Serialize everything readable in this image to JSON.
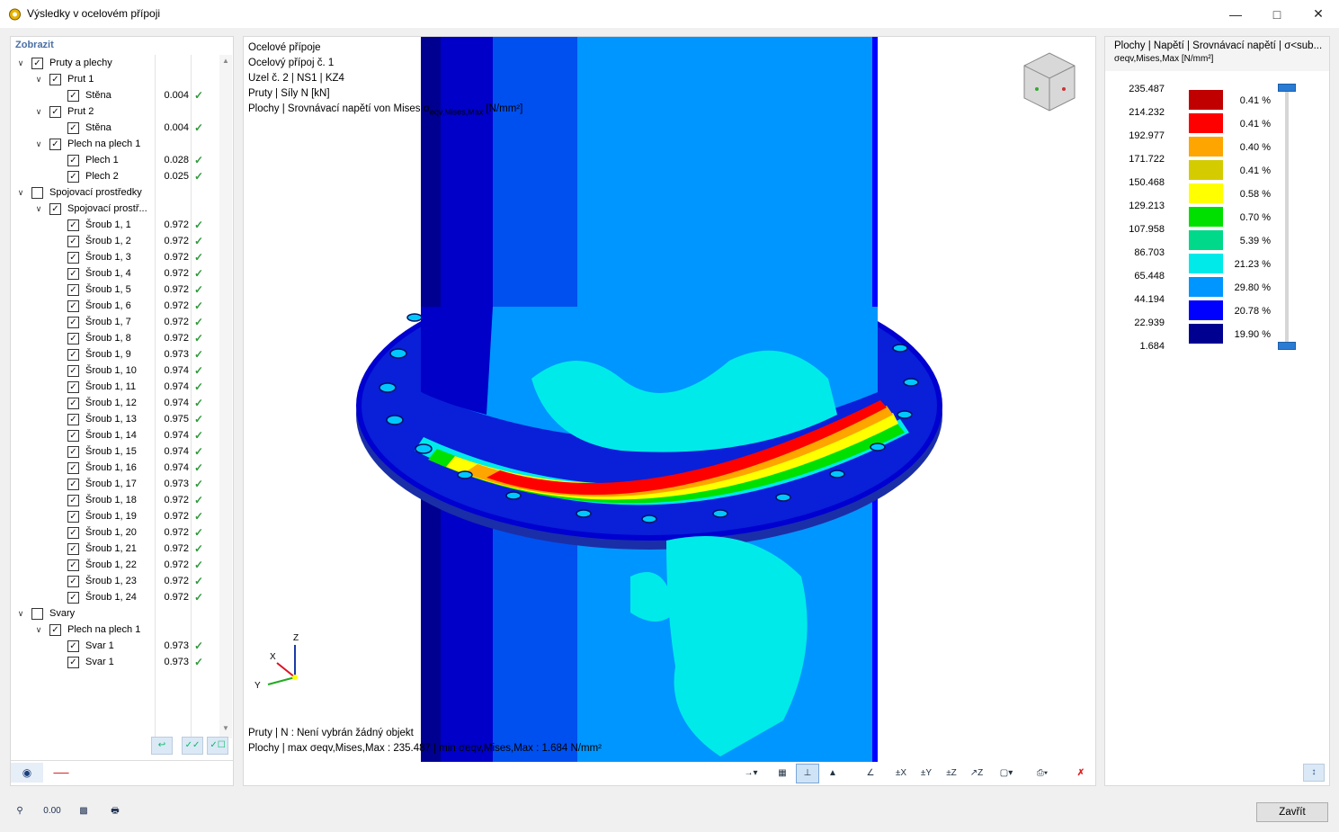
{
  "window": {
    "title": "Výsledky v ocelovém přípoji"
  },
  "left_panel": {
    "header": "Zobrazit",
    "tree": [
      {
        "level": 0,
        "expand": true,
        "checked": true,
        "label": "Pruty a plechy",
        "value": "",
        "ok": false
      },
      {
        "level": 1,
        "expand": true,
        "checked": true,
        "label": "Prut 1",
        "value": "",
        "ok": false
      },
      {
        "level": 2,
        "expand": false,
        "checked": true,
        "label": "Stěna",
        "value": "0.004",
        "ok": true
      },
      {
        "level": 1,
        "expand": true,
        "checked": true,
        "label": "Prut 2",
        "value": "",
        "ok": false
      },
      {
        "level": 2,
        "expand": false,
        "checked": true,
        "label": "Stěna",
        "value": "0.004",
        "ok": true
      },
      {
        "level": 1,
        "expand": true,
        "checked": true,
        "label": "Plech na plech 1",
        "value": "",
        "ok": false
      },
      {
        "level": 2,
        "expand": false,
        "checked": true,
        "label": "Plech 1",
        "value": "0.028",
        "ok": true
      },
      {
        "level": 2,
        "expand": false,
        "checked": true,
        "label": "Plech 2",
        "value": "0.025",
        "ok": true
      },
      {
        "level": 0,
        "expand": true,
        "checked": false,
        "label": "Spojovací prostředky",
        "value": "",
        "ok": false
      },
      {
        "level": 1,
        "expand": true,
        "checked": true,
        "label": "Spojovací prostř...",
        "value": "",
        "ok": false
      },
      {
        "level": 2,
        "expand": false,
        "checked": true,
        "label": "Šroub 1, 1",
        "value": "0.972",
        "ok": true
      },
      {
        "level": 2,
        "expand": false,
        "checked": true,
        "label": "Šroub 1, 2",
        "value": "0.972",
        "ok": true
      },
      {
        "level": 2,
        "expand": false,
        "checked": true,
        "label": "Šroub 1, 3",
        "value": "0.972",
        "ok": true
      },
      {
        "level": 2,
        "expand": false,
        "checked": true,
        "label": "Šroub 1, 4",
        "value": "0.972",
        "ok": true
      },
      {
        "level": 2,
        "expand": false,
        "checked": true,
        "label": "Šroub 1, 5",
        "value": "0.972",
        "ok": true
      },
      {
        "level": 2,
        "expand": false,
        "checked": true,
        "label": "Šroub 1, 6",
        "value": "0.972",
        "ok": true
      },
      {
        "level": 2,
        "expand": false,
        "checked": true,
        "label": "Šroub 1, 7",
        "value": "0.972",
        "ok": true
      },
      {
        "level": 2,
        "expand": false,
        "checked": true,
        "label": "Šroub 1, 8",
        "value": "0.972",
        "ok": true
      },
      {
        "level": 2,
        "expand": false,
        "checked": true,
        "label": "Šroub 1, 9",
        "value": "0.973",
        "ok": true
      },
      {
        "level": 2,
        "expand": false,
        "checked": true,
        "label": "Šroub 1, 10",
        "value": "0.974",
        "ok": true
      },
      {
        "level": 2,
        "expand": false,
        "checked": true,
        "label": "Šroub 1, 11",
        "value": "0.974",
        "ok": true
      },
      {
        "level": 2,
        "expand": false,
        "checked": true,
        "label": "Šroub 1, 12",
        "value": "0.974",
        "ok": true
      },
      {
        "level": 2,
        "expand": false,
        "checked": true,
        "label": "Šroub 1, 13",
        "value": "0.975",
        "ok": true
      },
      {
        "level": 2,
        "expand": false,
        "checked": true,
        "label": "Šroub 1, 14",
        "value": "0.974",
        "ok": true
      },
      {
        "level": 2,
        "expand": false,
        "checked": true,
        "label": "Šroub 1, 15",
        "value": "0.974",
        "ok": true
      },
      {
        "level": 2,
        "expand": false,
        "checked": true,
        "label": "Šroub 1, 16",
        "value": "0.974",
        "ok": true
      },
      {
        "level": 2,
        "expand": false,
        "checked": true,
        "label": "Šroub 1, 17",
        "value": "0.973",
        "ok": true
      },
      {
        "level": 2,
        "expand": false,
        "checked": true,
        "label": "Šroub 1, 18",
        "value": "0.972",
        "ok": true
      },
      {
        "level": 2,
        "expand": false,
        "checked": true,
        "label": "Šroub 1, 19",
        "value": "0.972",
        "ok": true
      },
      {
        "level": 2,
        "expand": false,
        "checked": true,
        "label": "Šroub 1, 20",
        "value": "0.972",
        "ok": true
      },
      {
        "level": 2,
        "expand": false,
        "checked": true,
        "label": "Šroub 1, 21",
        "value": "0.972",
        "ok": true
      },
      {
        "level": 2,
        "expand": false,
        "checked": true,
        "label": "Šroub 1, 22",
        "value": "0.972",
        "ok": true
      },
      {
        "level": 2,
        "expand": false,
        "checked": true,
        "label": "Šroub 1, 23",
        "value": "0.972",
        "ok": true
      },
      {
        "level": 2,
        "expand": false,
        "checked": true,
        "label": "Šroub 1, 24",
        "value": "0.972",
        "ok": true
      },
      {
        "level": 0,
        "expand": true,
        "checked": false,
        "label": "Svary",
        "value": "",
        "ok": false
      },
      {
        "level": 1,
        "expand": true,
        "checked": true,
        "label": "Plech na plech 1",
        "value": "",
        "ok": false
      },
      {
        "level": 2,
        "expand": false,
        "checked": true,
        "label": "Svar 1",
        "value": "0.973",
        "ok": true
      },
      {
        "level": 2,
        "expand": false,
        "checked": true,
        "label": "Svar 1",
        "value": "0.973",
        "ok": true
      }
    ]
  },
  "view": {
    "info_lines": [
      "Ocelové přípoje",
      "Ocelový přípoj č. 1",
      "Uzel č. 2 | NS1 | KZ4",
      "Pruty | Síly N [kN]"
    ],
    "info_line5": "Plochy | Srovnávací napětí von Mises σ",
    "info_line5_sub": "eqv,Mises,Max",
    "info_line5_unit": "[N/mm²]",
    "bottom_line1": "Pruty | N : Není vybrán žádný objekt",
    "bottom_line2": "Plochy | max σeqv,Mises,Max : 235.487 | min σeqv,Mises,Max : 1.684 N/mm²",
    "axis_z": "Z",
    "axis_x": "X",
    "axis_y": "Y"
  },
  "legend": {
    "title": "Plochy | Napětí | Srovnávací napětí | σ<sub...",
    "subtitle": "σeqv,Mises,Max [N/mm²]",
    "values": [
      "235.487",
      "214.232",
      "192.977",
      "171.722",
      "150.468",
      "129.213",
      "107.958",
      "86.703",
      "65.448",
      "44.194",
      "22.939",
      "1.684"
    ],
    "bands": [
      {
        "color": "#c00000",
        "pct": "0.41 %"
      },
      {
        "color": "#ff0000",
        "pct": "0.41 %"
      },
      {
        "color": "#ffa500",
        "pct": "0.40 %"
      },
      {
        "color": "#d4cc00",
        "pct": "0.41 %"
      },
      {
        "color": "#ffff00",
        "pct": "0.58 %"
      },
      {
        "color": "#00e000",
        "pct": "0.70 %"
      },
      {
        "color": "#00d98a",
        "pct": "5.39 %"
      },
      {
        "color": "#00eaea",
        "pct": "21.23 %"
      },
      {
        "color": "#0096ff",
        "pct": "29.80 %"
      },
      {
        "color": "#0000ff",
        "pct": "20.78 %"
      },
      {
        "color": "#000090",
        "pct": "19.90 %"
      }
    ]
  },
  "footer": {
    "close_label": "Zavřít"
  }
}
